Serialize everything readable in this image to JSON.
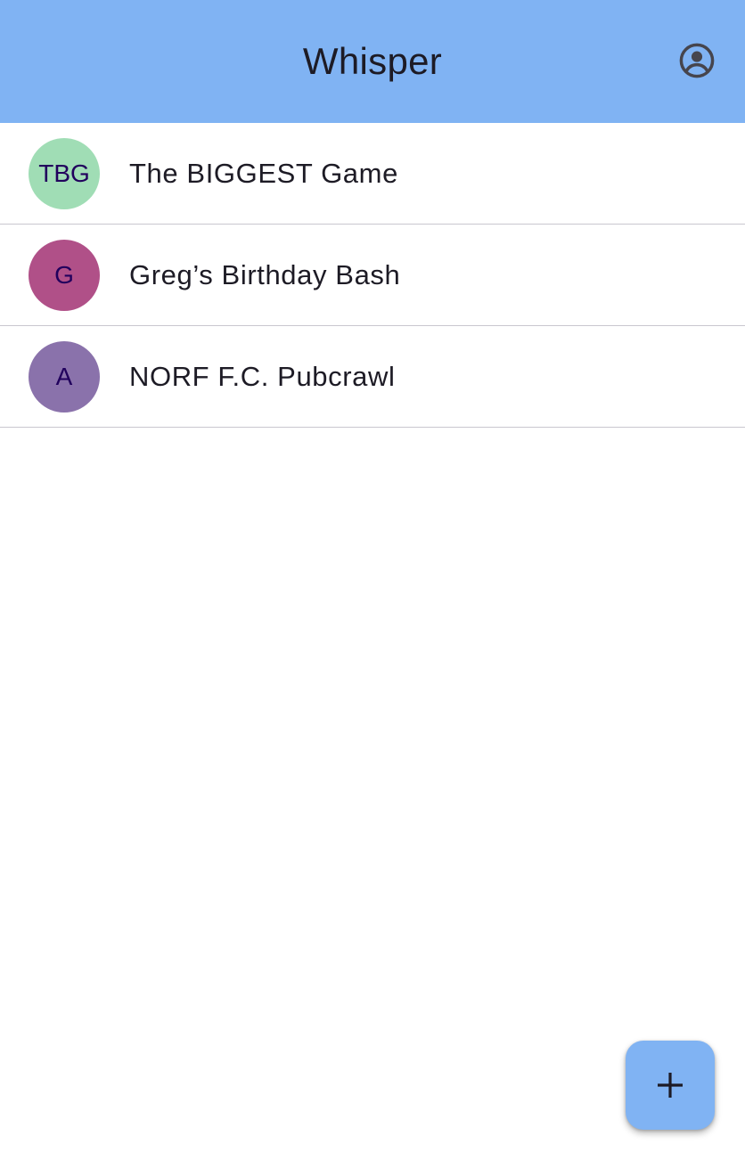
{
  "app_bar": {
    "title": "Whisper",
    "background": "#80b3f3",
    "profile_icon": "account-circle-icon"
  },
  "chats": [
    {
      "initials": "TBG",
      "name": "The BIGGEST Game",
      "avatar_color": "#a0ddb5"
    },
    {
      "initials": "G",
      "name": "Greg’s Birthday Bash",
      "avatar_color": "#b05088"
    },
    {
      "initials": "A",
      "name": "NORF F.C. Pubcrawl",
      "avatar_color": "#8a72ab"
    }
  ],
  "fab": {
    "icon": "plus-icon",
    "background": "#80b3f3"
  }
}
